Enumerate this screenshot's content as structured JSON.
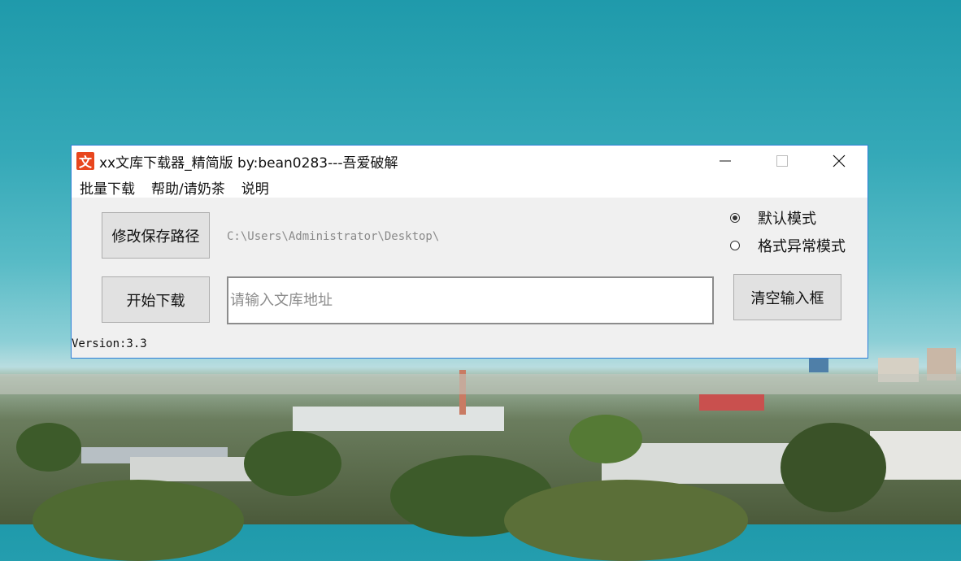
{
  "window": {
    "icon_glyph": "文",
    "title": "xx文库下载器_精简版  by:bean0283---吾爱破解",
    "controls": [
      "minimize-icon",
      "maximize-icon",
      "close-icon"
    ]
  },
  "menu": {
    "items": [
      {
        "label": "批量下载"
      },
      {
        "label": "帮助/请奶茶"
      },
      {
        "label": "说明"
      }
    ]
  },
  "main": {
    "change_path_button": "修改保存路径",
    "save_path": "C:\\Users\\Administrator\\Desktop\\",
    "start_download_button": "开始下载",
    "url_input": {
      "value": "",
      "placeholder": "请输入文库地址"
    },
    "clear_button": "清空输入框",
    "modes": [
      {
        "label": "默认模式",
        "selected": true
      },
      {
        "label": "格式异常模式",
        "selected": false
      }
    ],
    "version": "Version:3.3"
  },
  "colors": {
    "window_border": "#2f7fd8",
    "icon_bg": "#e8461d",
    "button_bg": "#e1e1e1"
  }
}
